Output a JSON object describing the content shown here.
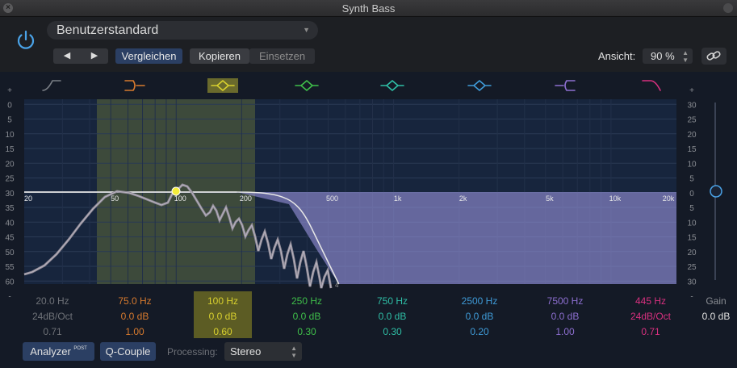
{
  "window": {
    "title": "Synth Bass"
  },
  "header": {
    "preset": "Benutzerstandard",
    "prev_label": "◀",
    "next_label": "▶",
    "compare_label": "Vergleichen",
    "copy_label": "Kopieren",
    "paste_label": "Einsetzen",
    "view_label": "Ansicht:",
    "view_value": "90 %"
  },
  "eq": {
    "db_left_ticks": [
      "+",
      "0",
      "5",
      "10",
      "15",
      "20",
      "25",
      "30",
      "35",
      "40",
      "45",
      "50",
      "55",
      "60",
      "-"
    ],
    "db_right_ticks": [
      "+",
      "30",
      "25",
      "20",
      "15",
      "10",
      "5",
      "0",
      "5",
      "10",
      "15",
      "20",
      "25",
      "30",
      "-"
    ],
    "freq_labels": [
      "20",
      "50",
      "100",
      "200",
      "500",
      "1k",
      "2k",
      "5k",
      "10k",
      "20k"
    ],
    "analyzer_marker": "4",
    "bands": [
      {
        "freq": "20.0 Hz",
        "gain": "24dB/Oct",
        "q": "0.71",
        "color": "#7a7f86",
        "icon": "low-cut-icon"
      },
      {
        "freq": "75.0 Hz",
        "gain": "0.0 dB",
        "q": "1.00",
        "color": "#d77a2e",
        "icon": "low-shelf-icon"
      },
      {
        "freq": "100 Hz",
        "gain": "0.0 dB",
        "q": "0.60",
        "color": "#d8d02e",
        "icon": "bell-icon"
      },
      {
        "freq": "250 Hz",
        "gain": "0.0 dB",
        "q": "0.30",
        "color": "#3fbf4a",
        "icon": "bell-icon"
      },
      {
        "freq": "750 Hz",
        "gain": "0.0 dB",
        "q": "0.30",
        "color": "#2fbfa6",
        "icon": "bell-icon"
      },
      {
        "freq": "2500 Hz",
        "gain": "0.0 dB",
        "q": "0.20",
        "color": "#3f9bd8",
        "icon": "bell-icon"
      },
      {
        "freq": "7500 Hz",
        "gain": "0.0 dB",
        "q": "1.00",
        "color": "#8d6fd0",
        "icon": "high-shelf-icon"
      },
      {
        "freq": "445 Hz",
        "gain": "24dB/Oct",
        "q": "0.71",
        "color": "#d8307f",
        "icon": "high-cut-icon"
      }
    ],
    "gain_label": "Gain",
    "gain_value": "0.0 dB"
  },
  "bottom": {
    "analyzer_label": "Analyzer",
    "analyzer_badge": "POST",
    "qcouple_label": "Q-Couple",
    "processing_label": "Processing:",
    "processing_value": "Stereo"
  }
}
